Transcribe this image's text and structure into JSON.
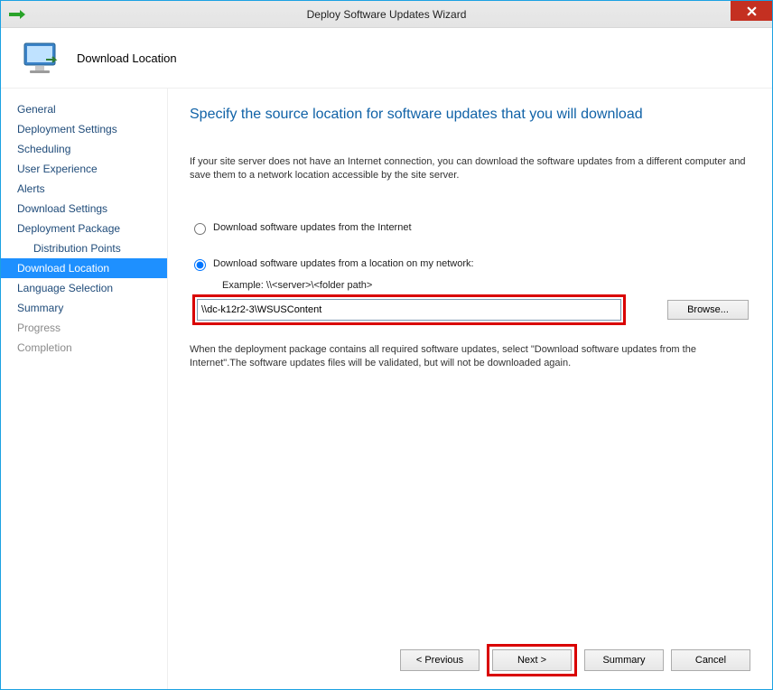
{
  "window": {
    "title": "Deploy Software Updates Wizard"
  },
  "header": {
    "page_name": "Download Location"
  },
  "sidebar": {
    "items": [
      {
        "label": "General",
        "state": "normal"
      },
      {
        "label": "Deployment Settings",
        "state": "normal"
      },
      {
        "label": "Scheduling",
        "state": "normal"
      },
      {
        "label": "User Experience",
        "state": "normal"
      },
      {
        "label": "Alerts",
        "state": "normal"
      },
      {
        "label": "Download Settings",
        "state": "normal"
      },
      {
        "label": "Deployment Package",
        "state": "normal"
      },
      {
        "label": "Distribution Points",
        "state": "child"
      },
      {
        "label": "Download Location",
        "state": "active"
      },
      {
        "label": "Language Selection",
        "state": "normal"
      },
      {
        "label": "Summary",
        "state": "normal"
      },
      {
        "label": "Progress",
        "state": "completed"
      },
      {
        "label": "Completion",
        "state": "completed"
      }
    ]
  },
  "main": {
    "title": "Specify the source location for software updates that you will download",
    "intro": "If your site server does not have an Internet connection, you can download the software updates from a different computer and save them to a network location accessible by the site server.",
    "radio_internet": "Download software updates from the Internet",
    "radio_network": "Download software updates from a location on my network:",
    "example_label": "Example: \\\\<server>\\<folder path>",
    "path_value": "\\\\dc-k12r2-3\\WSUSContent",
    "browse_label": "Browse...",
    "note": "When the deployment package contains all required software updates, select \"Download  software updates from the Internet\".The software updates files will be validated, but will not be downloaded again."
  },
  "footer": {
    "previous": "< Previous",
    "next": "Next >",
    "summary": "Summary",
    "cancel": "Cancel"
  }
}
